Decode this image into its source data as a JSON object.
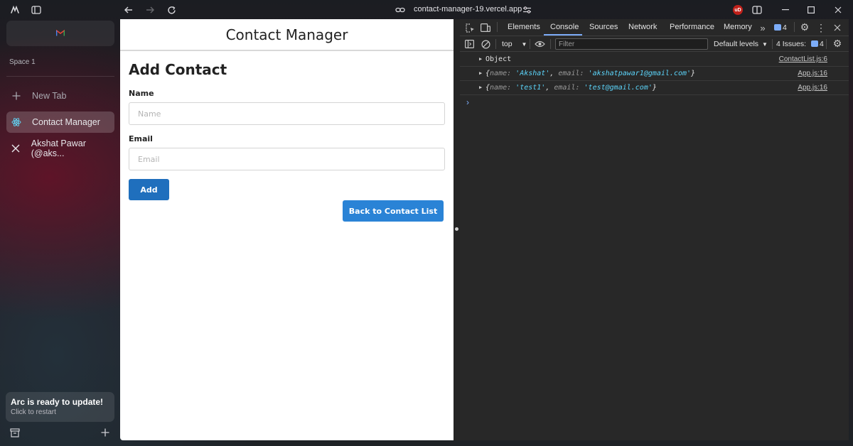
{
  "browser": {
    "url": "contact-manager-19.vercel.app",
    "extension_badge": "uD"
  },
  "sidebar": {
    "space_label": "Space 1",
    "new_tab_label": "New Tab",
    "tabs": [
      {
        "label": "Contact Manager",
        "icon": "react-icon",
        "active": true
      },
      {
        "label": "Akshat Pawar (@aks...",
        "icon": "x-logo-icon",
        "active": false
      }
    ],
    "update_card": {
      "title": "Arc is ready to update!",
      "subtitle": "Click to restart"
    }
  },
  "page": {
    "header_title": "Contact Manager",
    "form_title": "Add Contact",
    "name_label": "Name",
    "name_placeholder": "Name",
    "email_label": "Email",
    "email_placeholder": "Email",
    "add_button": "Add",
    "back_button": "Back to Contact List"
  },
  "devtools": {
    "tabs": [
      "Elements",
      "Console",
      "Sources",
      "Network",
      "Performance",
      "Memory"
    ],
    "active_tab": "Console",
    "issues_badge_count": "4",
    "context": "top",
    "filter_placeholder": "Filter",
    "levels": "Default levels",
    "issues_label": "4 Issues:",
    "issues_count": "4",
    "console": [
      {
        "text": "Object",
        "source": "ContactList.js:6"
      },
      {
        "open": "{",
        "k1": "name",
        "colon1": ": ",
        "v1": "'Akshat'",
        "comma": ", ",
        "k2": "email",
        "colon2": ": ",
        "v2": "'akshatpawar1@gmail.com'",
        "close": "}",
        "source": "App.js:16"
      },
      {
        "open": "{",
        "k1": "name",
        "colon1": ": ",
        "v1": "'test1'",
        "comma": ", ",
        "k2": "email",
        "colon2": ": ",
        "v2": "'test@gmail.com'",
        "close": "}",
        "source": "App.js:16"
      }
    ]
  }
}
